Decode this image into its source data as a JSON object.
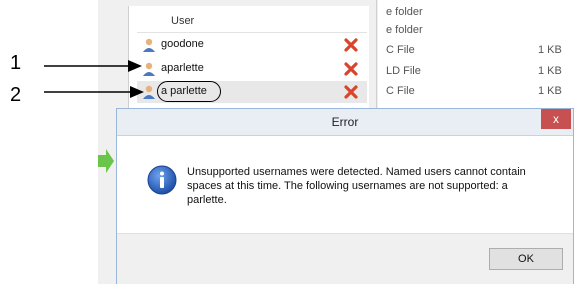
{
  "user_list": {
    "header": "User",
    "users": [
      {
        "name": "goodone"
      },
      {
        "name": "aparlette"
      },
      {
        "name": "a parlette"
      }
    ]
  },
  "file_list": {
    "rows": [
      {
        "type": "e folder",
        "size": ""
      },
      {
        "type": "e folder",
        "size": ""
      },
      {
        "type": "C File",
        "size": "1 KB"
      },
      {
        "type": "LD File",
        "size": "1 KB"
      },
      {
        "type": "C File",
        "size": "1 KB"
      }
    ]
  },
  "callouts": [
    {
      "label": "1"
    },
    {
      "label": "2"
    }
  ],
  "dialog": {
    "title": "Error",
    "close_label": "x",
    "message": "Unsupported usernames were detected. Named users cannot contain spaces at this time. The following usernames are not supported: a parlette.",
    "ok_label": "OK"
  },
  "colors": {
    "close_button": "#c75050",
    "info_icon": "#2a64c5",
    "delete_icon": "#d9442b",
    "arrow_green": "#6bc54a"
  }
}
